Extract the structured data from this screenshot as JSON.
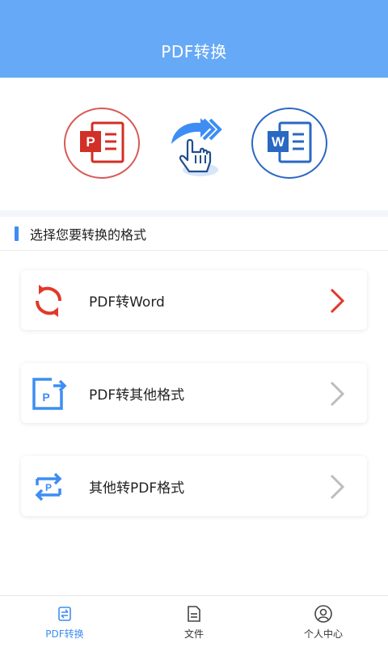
{
  "header": {
    "title": "PDF转换"
  },
  "hero": {
    "left_icon": "powerpoint-file-icon",
    "center_icon": "swipe-hand-arrow-icon",
    "right_icon": "word-file-icon",
    "left_letter": "P",
    "right_letter": "W"
  },
  "section": {
    "title": "选择您要转换的格式"
  },
  "options": [
    {
      "label": "PDF转Word",
      "icon": "convert-cycle-icon",
      "accent": "#e2382b"
    },
    {
      "label": "PDF转其他格式",
      "icon": "pdf-export-icon",
      "accent": "#3d8df4"
    },
    {
      "label": "其他转PDF格式",
      "icon": "swap-pdf-icon",
      "accent": "#3d8df4"
    }
  ],
  "tabbar": {
    "tabs": [
      {
        "label": "PDF转换",
        "icon": "convert-icon",
        "active": true
      },
      {
        "label": "文件",
        "icon": "file-icon",
        "active": false
      },
      {
        "label": "个人中心",
        "icon": "profile-icon",
        "active": false
      }
    ]
  },
  "colors": {
    "header_bg": "#66a9f6",
    "accent_blue": "#3d8df4",
    "accent_red": "#e2382b"
  }
}
